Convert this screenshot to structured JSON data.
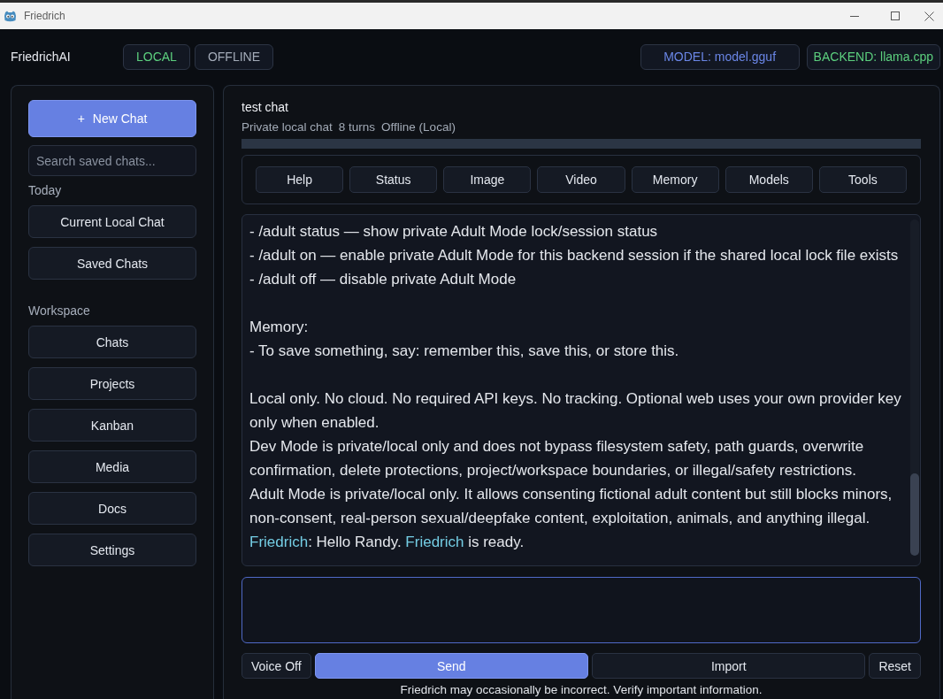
{
  "window": {
    "title": "Friedrich"
  },
  "header": {
    "brand": "FriedrichAI",
    "mode_badges": [
      {
        "text": "LOCAL",
        "color": "#5ccf7e"
      },
      {
        "text": "OFFLINE",
        "color": "#a3abb8"
      }
    ],
    "status_badges": [
      {
        "text": "MODEL: model.gguf",
        "color": "#6a86e6"
      },
      {
        "text": "BACKEND: llama.cpp",
        "color": "#5ccf7e"
      }
    ]
  },
  "sidebar": {
    "new_chat": {
      "icon": "+",
      "label": "New Chat"
    },
    "search": {
      "placeholder": "Search saved chats..."
    },
    "sections": [
      {
        "title": "Today",
        "items": [
          "Current Local Chat",
          "Saved Chats"
        ]
      },
      {
        "title": "Workspace",
        "items": [
          "Chats",
          "Projects",
          "Kanban",
          "Media",
          "Docs",
          "Settings"
        ]
      }
    ]
  },
  "chat": {
    "title": "test chat",
    "meta": [
      "Private local chat",
      "8 turns",
      "Offline (Local)"
    ],
    "commands": [
      "Help",
      "Status",
      "Image",
      "Video",
      "Memory",
      "Models",
      "Tools"
    ],
    "transcript": [
      {
        "lines": [
          [
            {
              "kind": "text",
              "text": "- /adult status — show private Adult Mode lock/session status"
            }
          ],
          [
            {
              "kind": "text",
              "text": "- /adult on — enable private Adult Mode for this backend session if the shared local lock file exists"
            }
          ],
          [
            {
              "kind": "text",
              "text": "- /adult off — disable private Adult Mode"
            }
          ]
        ]
      },
      {
        "lines": [
          [
            {
              "kind": "text",
              "text": "Memory:"
            }
          ],
          [
            {
              "kind": "text",
              "text": "- To save something, say: remember this, save this, or store this."
            }
          ]
        ]
      },
      {
        "lines": [
          [
            {
              "kind": "text",
              "text": "Local only. No cloud. No required API keys. No tracking. Optional web uses your own provider key only when enabled."
            }
          ],
          [
            {
              "kind": "text",
              "text": "Dev Mode is private/local only and does not bypass filesystem safety, path guards, overwrite confirmation, delete protections, project/workspace boundaries, or illegal/safety restrictions."
            }
          ],
          [
            {
              "kind": "text",
              "text": "Adult Mode is private/local only. It allows consenting fictional adult content but still blocks minors, non-consent, real-person sexual/deepfake content, exploitation, animals, and anything illegal."
            }
          ],
          [
            {
              "kind": "name",
              "text": "Friedrich"
            },
            {
              "kind": "text",
              "text": ": Hello Randy. "
            },
            {
              "kind": "name",
              "text": "Friedrich"
            },
            {
              "kind": "text",
              "text": " is ready."
            }
          ]
        ]
      }
    ],
    "actions": [
      {
        "label": "Voice Off",
        "kind": "default"
      },
      {
        "label": "Send",
        "kind": "primary"
      },
      {
        "label": "Import",
        "kind": "wide"
      },
      {
        "label": "Reset",
        "kind": "default"
      }
    ],
    "disclaimer": "Friedrich may occasionally be incorrect. Verify important information."
  }
}
